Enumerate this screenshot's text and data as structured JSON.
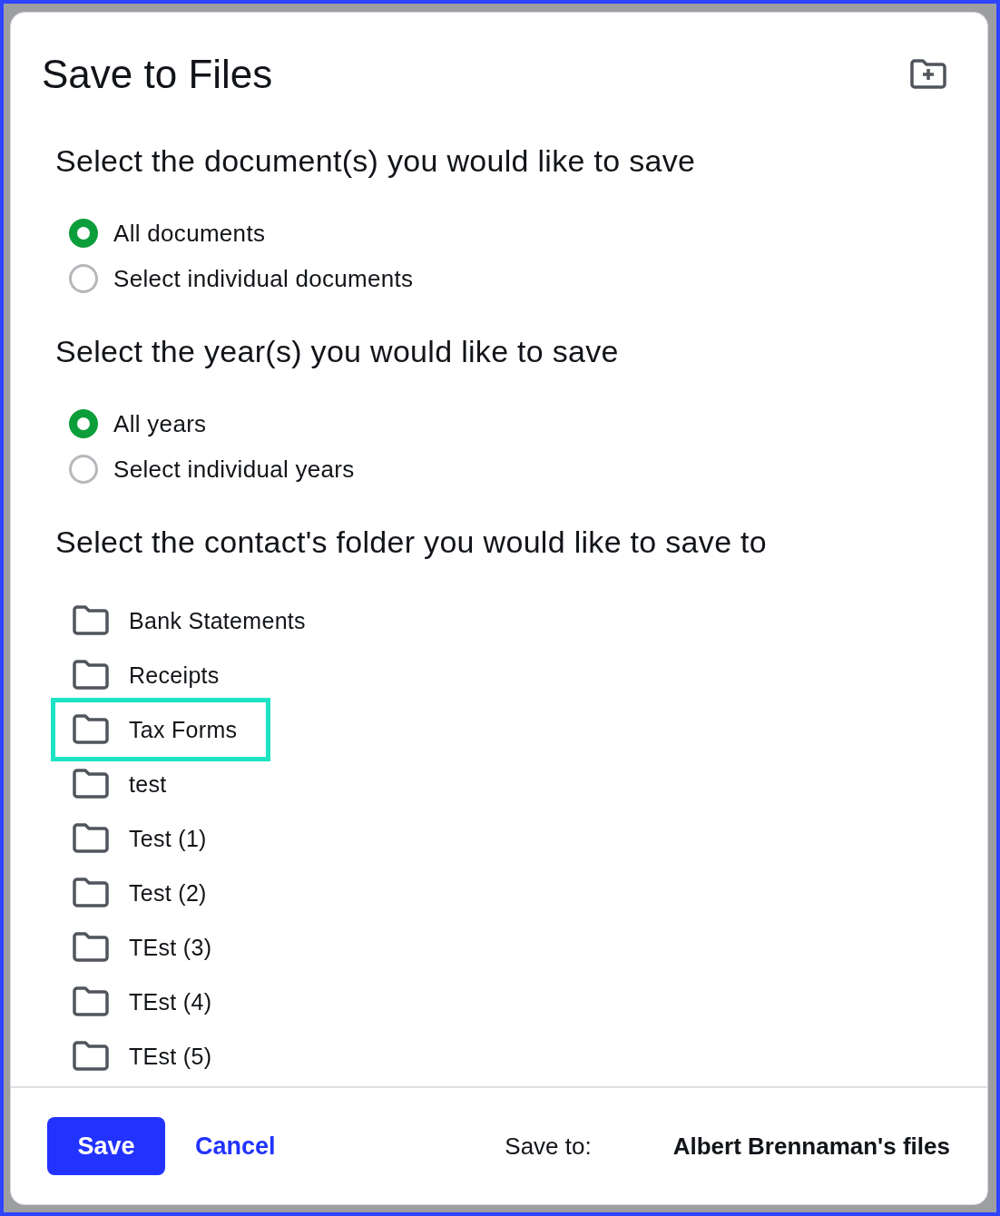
{
  "dialog": {
    "title": "Save to Files"
  },
  "sections": [
    {
      "heading": "Select the document(s) you would like to save",
      "kind": "radios",
      "options": [
        {
          "label": "All documents",
          "selected": true
        },
        {
          "label": "Select individual documents",
          "selected": false
        }
      ]
    },
    {
      "heading": "Select the year(s) you would like to save",
      "kind": "radios",
      "options": [
        {
          "label": "All years",
          "selected": true
        },
        {
          "label": "Select individual years",
          "selected": false
        }
      ]
    },
    {
      "heading": "Select the contact's folder you would like to save to",
      "kind": "folders",
      "folders": [
        {
          "name": "Bank Statements",
          "selected": false
        },
        {
          "name": "Receipts",
          "selected": false
        },
        {
          "name": "Tax Forms",
          "selected": true
        },
        {
          "name": "test",
          "selected": false
        },
        {
          "name": "Test (1)",
          "selected": false
        },
        {
          "name": "Test (2)",
          "selected": false
        },
        {
          "name": "TEst (3)",
          "selected": false
        },
        {
          "name": "TEst (4)",
          "selected": false
        },
        {
          "name": "TEst (5)",
          "selected": false
        }
      ]
    }
  ],
  "footer": {
    "save_button": "Save",
    "cancel_link": "Cancel",
    "destination_label": "Save to:",
    "destination": "Albert Brennaman's files"
  }
}
